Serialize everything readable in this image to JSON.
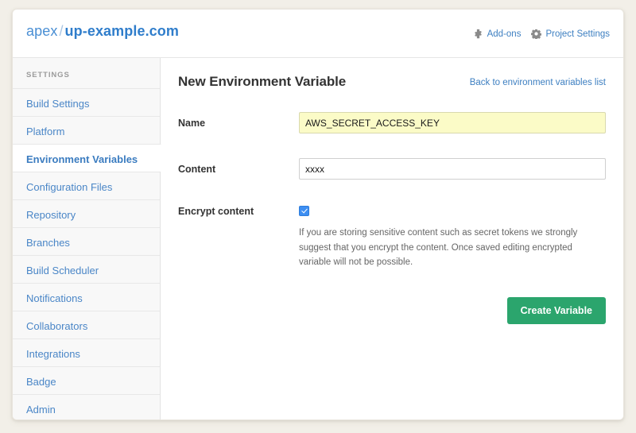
{
  "theme": {
    "page_bg": "#f2efe8",
    "accent_link": "#3d7fc1",
    "brand_blue": "#2f7dcb",
    "primary_button": "#2ba56d",
    "autofill_yellow": "#fbfbc7",
    "checkbox_blue": "#3d8ef2"
  },
  "header": {
    "org": "apex",
    "separator": "/",
    "project": "up-example.com",
    "links": [
      {
        "label": "Add-ons",
        "icon": "puzzle-piece-icon"
      },
      {
        "label": "Project Settings",
        "icon": "gear-icon"
      }
    ]
  },
  "sidebar": {
    "title": "SETTINGS",
    "items": [
      {
        "label": "Build Settings",
        "active": false
      },
      {
        "label": "Platform",
        "active": false
      },
      {
        "label": "Environment Variables",
        "active": true
      },
      {
        "label": "Configuration Files",
        "active": false
      },
      {
        "label": "Repository",
        "active": false
      },
      {
        "label": "Branches",
        "active": false
      },
      {
        "label": "Build Scheduler",
        "active": false
      },
      {
        "label": "Notifications",
        "active": false
      },
      {
        "label": "Collaborators",
        "active": false
      },
      {
        "label": "Integrations",
        "active": false
      },
      {
        "label": "Badge",
        "active": false
      },
      {
        "label": "Admin",
        "active": false
      }
    ]
  },
  "main": {
    "title": "New Environment Variable",
    "back_link": "Back to environment variables list",
    "form": {
      "name": {
        "label": "Name",
        "value": "AWS_SECRET_ACCESS_KEY",
        "placeholder": ""
      },
      "content": {
        "label": "Content",
        "value": "xxxx",
        "placeholder": ""
      },
      "encrypt": {
        "label": "Encrypt content",
        "checked": true,
        "help": "If you are storing sensitive content such as secret tokens we strongly suggest that you encrypt the content. Once saved editing encrypted variable will not be possible."
      },
      "submit_label": "Create Variable"
    }
  }
}
